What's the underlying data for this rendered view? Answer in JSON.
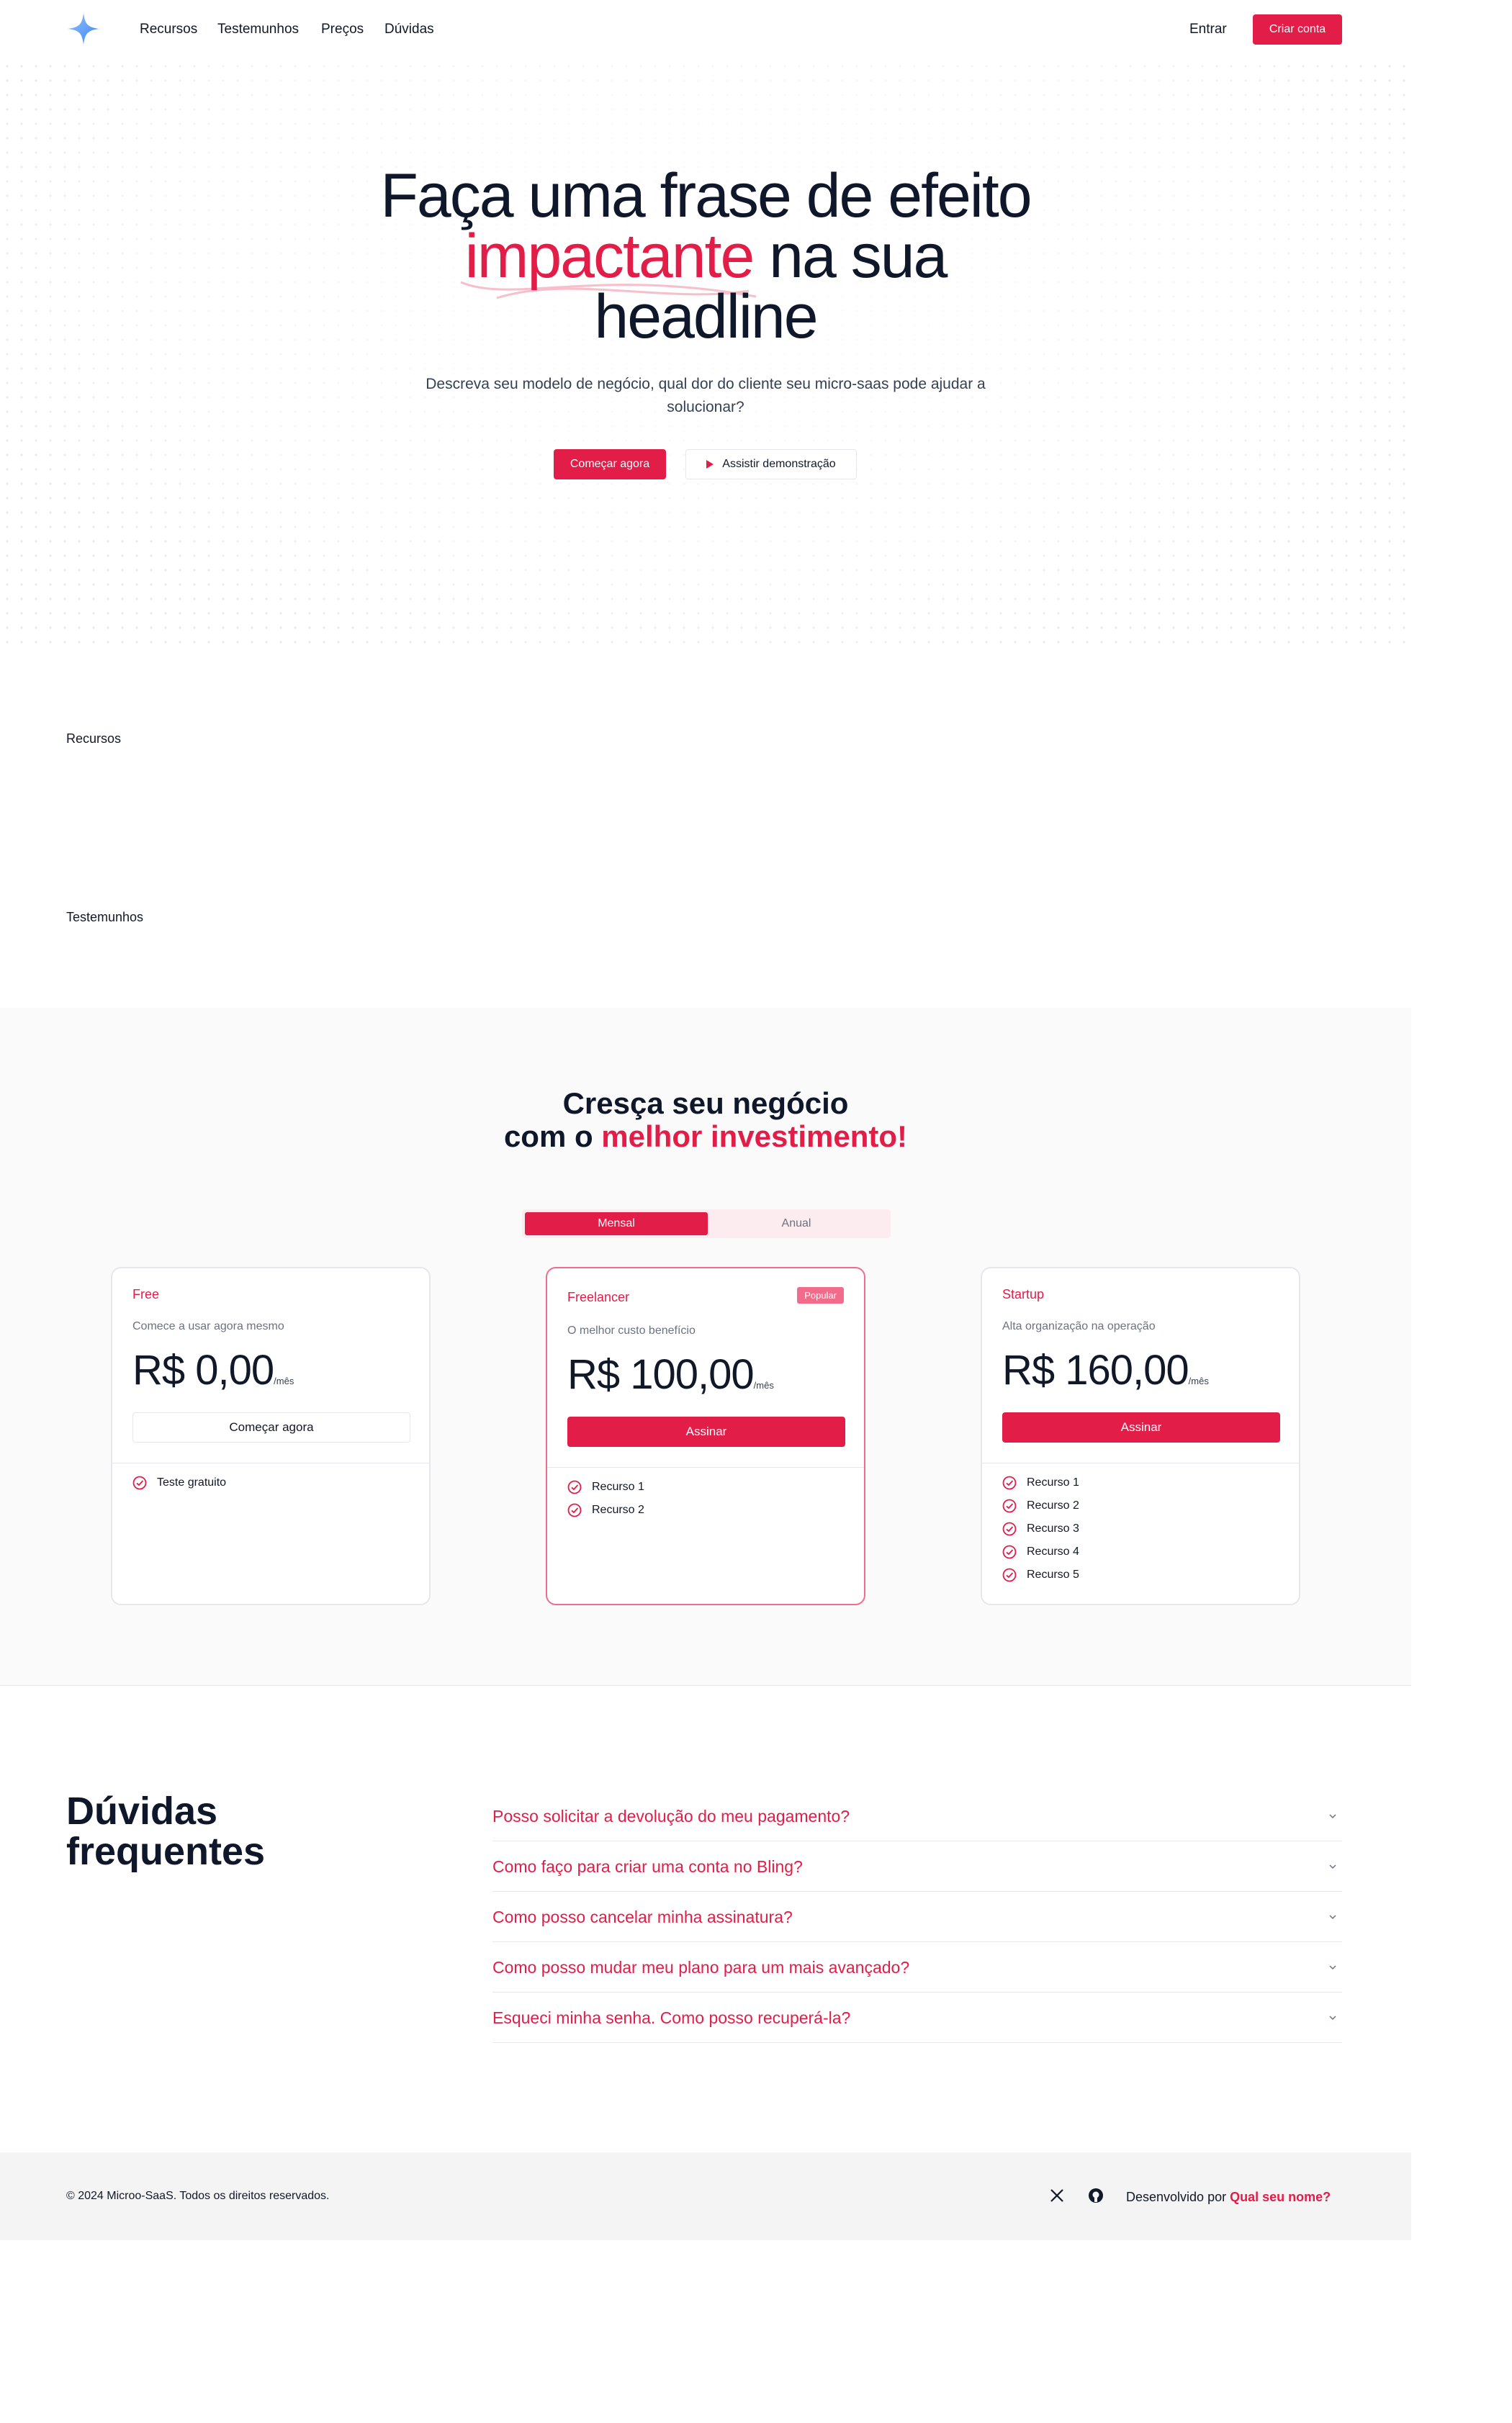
{
  "nav": {
    "logo_icon": "sparkle-star-icon",
    "links": [
      "Recursos",
      "Testemunhos",
      "Preços",
      "Dúvidas"
    ],
    "login_label": "Entrar",
    "signup_label": "Criar conta"
  },
  "hero": {
    "title_line1": "Faça uma frase de efeito",
    "title_accent": "impactante",
    "title_line2_rest": " na sua",
    "title_line3": "headline",
    "subtitle": "Descreva seu modelo de negócio, qual dor do cliente seu micro-saas pode ajudar a solucionar?",
    "cta_primary": "Começar agora",
    "cta_secondary": "Assistir demonstração"
  },
  "sections": {
    "features_label": "Recursos",
    "testimonials_label": "Testemunhos"
  },
  "pricing": {
    "title_line1": "Cresça seu negócio",
    "title_line2_prefix": "com o ",
    "title_line2_accent": "melhor investimento!",
    "toggle_monthly": "Mensal",
    "toggle_yearly": "Anual",
    "plans": [
      {
        "name": "Free",
        "description": "Comece a usar agora mesmo",
        "price": "R$ 0,00",
        "period": "/mês",
        "button": "Começar agora",
        "features": [
          "Teste gratuito"
        ]
      },
      {
        "name": "Freelancer",
        "badge": "Popular",
        "description": "O melhor custo benefício",
        "price": "R$ 100,00",
        "period": "/mês",
        "button": "Assinar",
        "features": [
          "Recurso 1",
          "Recurso 2"
        ]
      },
      {
        "name": "Startup",
        "description": "Alta organização na operação",
        "price": "R$ 160,00",
        "period": "/mês",
        "button": "Assinar",
        "features": [
          "Recurso 1",
          "Recurso 2",
          "Recurso 3",
          "Recurso 4",
          "Recurso 5"
        ]
      }
    ]
  },
  "faq": {
    "title_line1": "Dúvidas",
    "title_line2": "frequentes",
    "questions": [
      "Posso solicitar a devolução do meu pagamento?",
      "Como faço para criar uma conta no Bling?",
      "Como posso cancelar minha assinatura?",
      "Como posso mudar meu plano para um mais avançado?",
      "Esqueci minha senha. Como posso recuperá-la?"
    ]
  },
  "footer": {
    "copyright": "© 2024 Microo-SaaS. Todos os direitos reservados.",
    "social_icons": [
      "x-icon",
      "github-icon"
    ],
    "developed_by": "Desenvolvido por ",
    "developer_link": "Qual seu nome?"
  },
  "colors": {
    "accent": "#e11d48",
    "accent_light": "#f26b8a",
    "text": "#0f172a"
  }
}
